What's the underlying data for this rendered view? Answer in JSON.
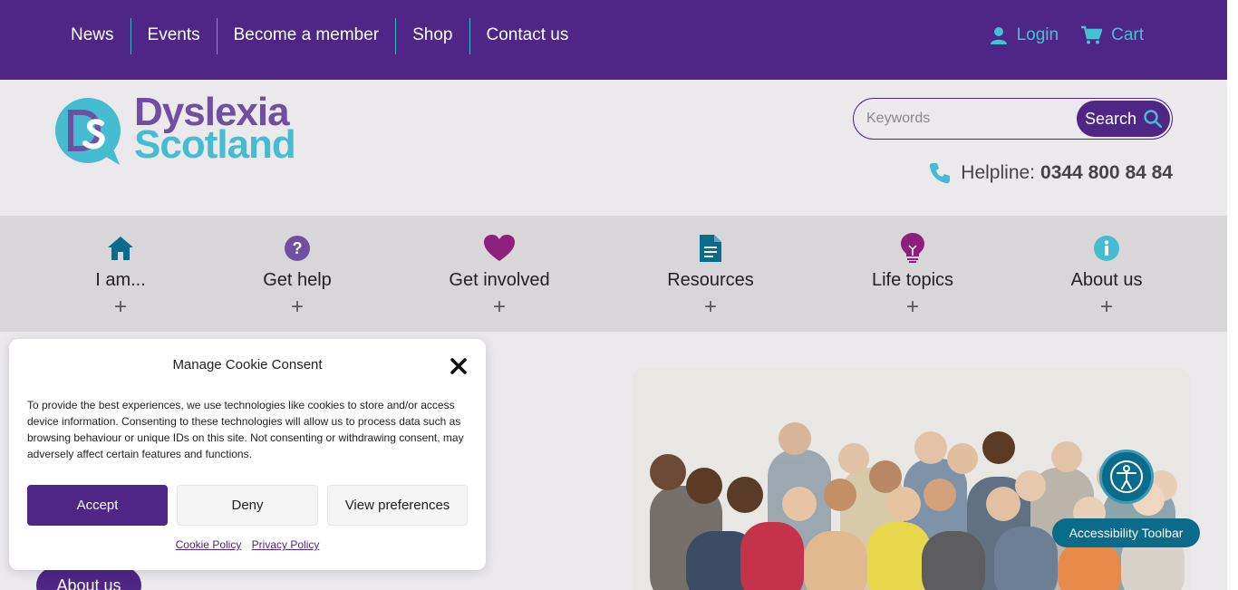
{
  "topnav": {
    "items": [
      "News",
      "Events",
      "Become a member",
      "Shop",
      "Contact us"
    ],
    "login": "Login",
    "cart": "Cart"
  },
  "header": {
    "logo_line1": "Dyslexia",
    "logo_line2": "Scotland",
    "search_placeholder": "Keywords",
    "search_button": "Search",
    "helpline_label": "Helpline:",
    "helpline_number": "0344 800 84 84"
  },
  "mainnav": {
    "items": [
      {
        "label": "I am...",
        "icon": "home-icon",
        "color": "#0a6b8a"
      },
      {
        "label": "Get help",
        "icon": "question-icon",
        "color": "#6e4fa0"
      },
      {
        "label": "Get involved",
        "icon": "heart-icon",
        "color": "#8e1f7a"
      },
      {
        "label": "Resources",
        "icon": "document-icon",
        "color": "#0a6b8a"
      },
      {
        "label": "Life topics",
        "icon": "lightbulb-icon",
        "color": "#8e1f7a"
      },
      {
        "label": "About us",
        "icon": "info-icon",
        "color": "#45bcd0"
      }
    ],
    "expand_symbol": "+"
  },
  "cookie": {
    "title": "Manage Cookie Consent",
    "text": "To provide the best experiences, we use technologies like cookies to store and/or access device information. Consenting to these technologies will allow us to process data such as browsing behaviour or unique IDs on this site. Not consenting or withdrawing consent, may adversely affect certain features and functions.",
    "accept": "Accept",
    "deny": "Deny",
    "preferences": "View preferences",
    "cookie_policy": "Cookie Policy",
    "privacy_policy": "Privacy Policy"
  },
  "body": {
    "about_button": "About us"
  },
  "accessibility": {
    "label": "Accessibility Toolbar"
  },
  "colors": {
    "brand_purple": "#4f2585",
    "brand_teal": "#45bcd0",
    "nav_bg": "#d8d6d9"
  }
}
